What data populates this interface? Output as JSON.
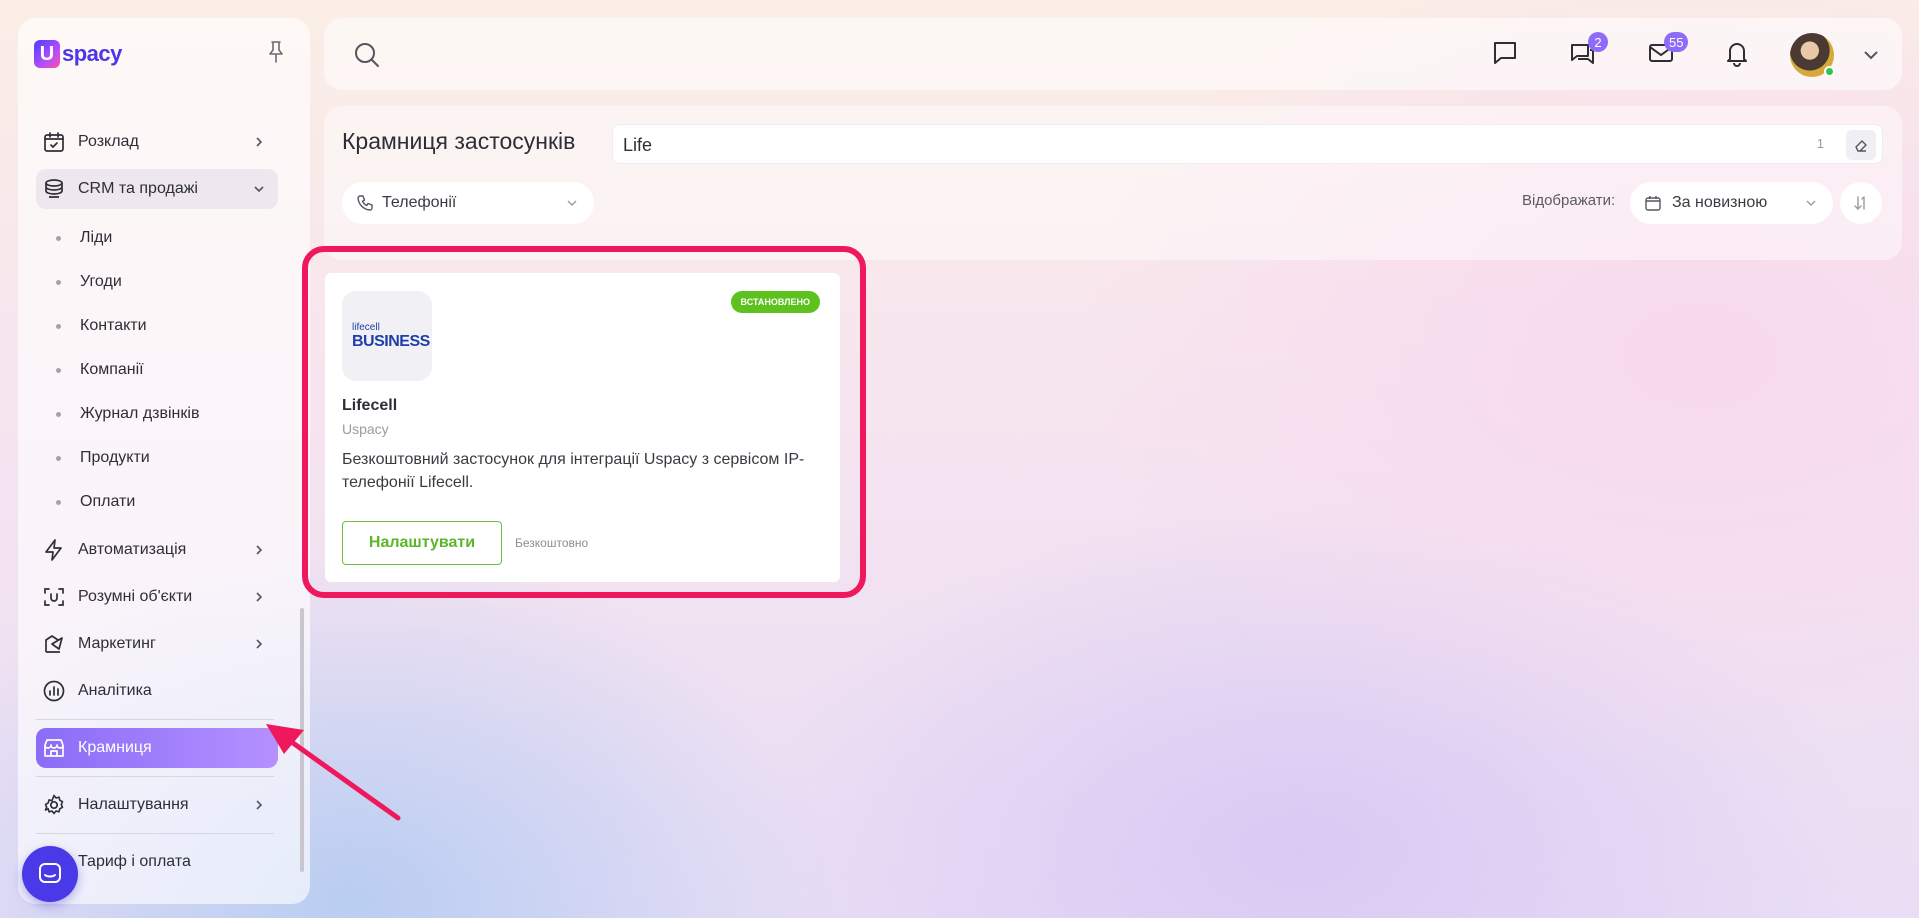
{
  "brand": {
    "logo_mark": "U",
    "name": "spacy"
  },
  "sidebar": {
    "items": [
      {
        "label": "Розклад",
        "icon": "calendar-icon"
      },
      {
        "label": "CRM та продажі",
        "icon": "crm-stack-icon"
      },
      {
        "label": "Автоматизація",
        "icon": "lightning-icon"
      },
      {
        "label": "Розумні об'єкти",
        "icon": "smart-objects-icon"
      },
      {
        "label": "Маркетинг",
        "icon": "marketing-icon"
      },
      {
        "label": "Аналітика",
        "icon": "analytics-icon"
      },
      {
        "label": "Крамниця",
        "icon": "store-icon"
      },
      {
        "label": "Налаштування",
        "icon": "gear-icon"
      },
      {
        "label": "Тариф і оплата",
        "icon": "tariff-icon"
      }
    ],
    "crm_subitems": [
      "Ліди",
      "Угоди",
      "Контакти",
      "Компанії",
      "Журнал дзвінків",
      "Продукти",
      "Оплати"
    ]
  },
  "header": {
    "chat_badge": "2",
    "mail_badge": "55"
  },
  "store": {
    "title": "Крамниця застосунків",
    "search_value": "Life",
    "result_count": "1",
    "filter_label": "Телефонії",
    "display_label": "Відображати:",
    "sort_label": "За новизною"
  },
  "app_card": {
    "logo_line1": "lifecell",
    "logo_line2": "BUSINESS",
    "status": "ВСТАНОВЛЕНО",
    "name": "Lifecell",
    "vendor": "Uspacy",
    "description": "Безкоштовний застосунок для інтеграції Uspacy з сервісом IP-телефонії Lifecell.",
    "configure_label": "Налаштувати",
    "price": "Безкоштовно"
  },
  "colors": {
    "accent": "#8a6cf7",
    "installed": "#5dc21e",
    "highlight": "#f0185c",
    "brand": "#4c36e8"
  }
}
